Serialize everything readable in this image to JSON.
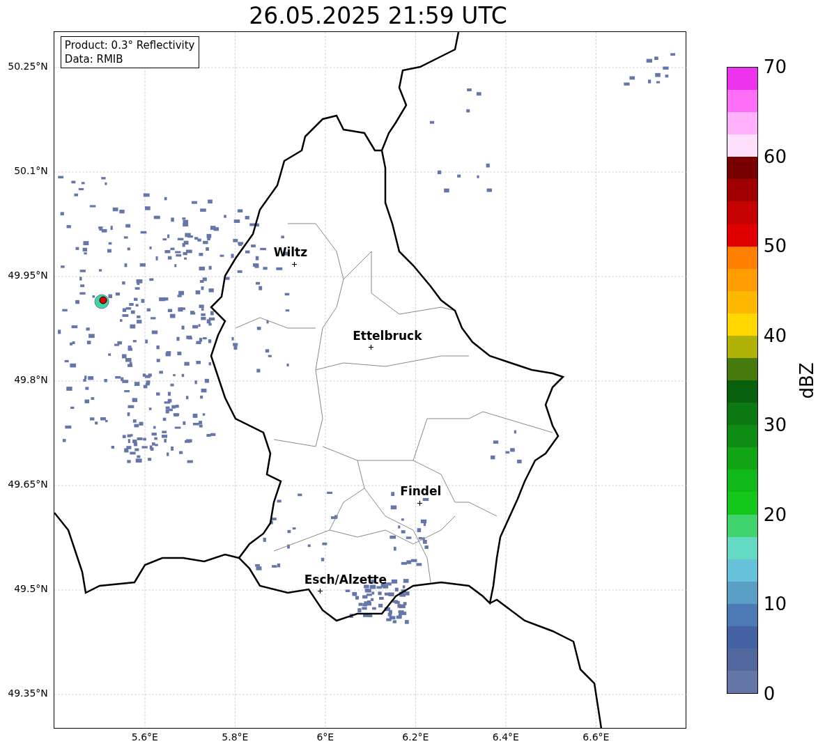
{
  "title": "26.05.2025 21:59 UTC",
  "info_box": [
    "Product: 0.3° Reflectivity",
    "Data: RMIB"
  ],
  "lat_labels": [
    "50.25°N",
    "50.1°N",
    "49.95°N",
    "49.8°N",
    "49.65°N",
    "49.5°N",
    "49.35°N"
  ],
  "lon_labels": [
    "5.6°E",
    "5.8°E",
    "6°E",
    "6.2°E",
    "6.4°E",
    "6.6°E"
  ],
  "cities": [
    {
      "name": "Wiltz"
    },
    {
      "name": "Ettelbruck"
    },
    {
      "name": "Findel"
    },
    {
      "name": "Esch/Alzette"
    }
  ],
  "colorbar": {
    "label": "dBZ",
    "ticks": [
      "70",
      "60",
      "50",
      "40",
      "30",
      "20",
      "10",
      "0"
    ],
    "segments": [
      {
        "color": "#6576a8"
      },
      {
        "color": "#53679f"
      },
      {
        "color": "#4361a3"
      },
      {
        "color": "#4b7ab4"
      },
      {
        "color": "#5aa0c6"
      },
      {
        "color": "#66c2da"
      },
      {
        "color": "#64d9c4"
      },
      {
        "color": "#40d46e"
      },
      {
        "color": "#13c81b"
      },
      {
        "color": "#11b81a"
      },
      {
        "color": "#11a516"
      },
      {
        "color": "#0e8c14"
      },
      {
        "color": "#0b7812"
      },
      {
        "color": "#07600c"
      },
      {
        "color": "#477a0c"
      },
      {
        "color": "#b1b208"
      },
      {
        "color": "#ffd700"
      },
      {
        "color": "#ffb800"
      },
      {
        "color": "#ff9c00"
      },
      {
        "color": "#ff7f00"
      },
      {
        "color": "#e00000"
      },
      {
        "color": "#c40000"
      },
      {
        "color": "#a00000"
      },
      {
        "color": "#780000"
      },
      {
        "color": "#ffe0fc"
      },
      {
        "color": "#ffb2fb"
      },
      {
        "color": "#ff6ef7"
      },
      {
        "color": "#ee33ee"
      }
    ]
  }
}
